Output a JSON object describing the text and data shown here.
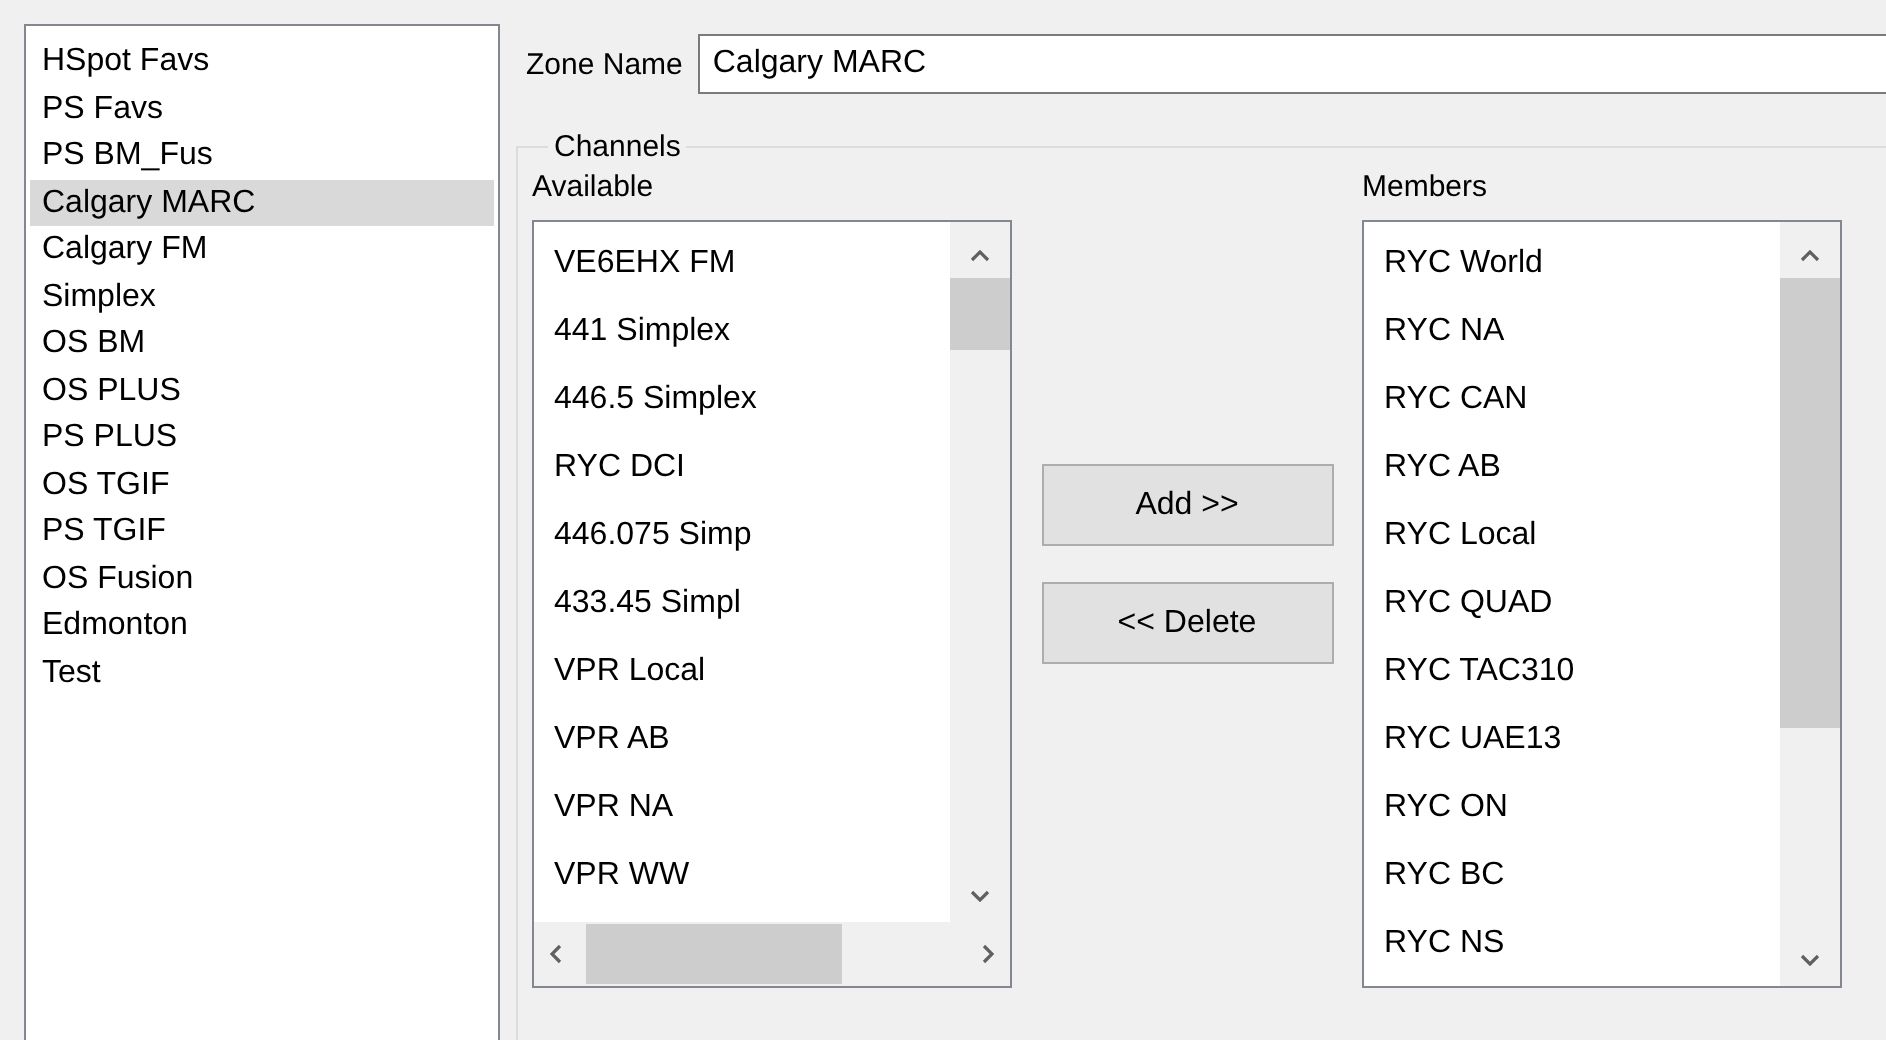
{
  "zones": [
    {
      "label": "HSpot Favs",
      "selected": false
    },
    {
      "label": "PS Favs",
      "selected": false
    },
    {
      "label": "PS BM_Fus",
      "selected": false
    },
    {
      "label": "Calgary MARC",
      "selected": true
    },
    {
      "label": "Calgary FM",
      "selected": false
    },
    {
      "label": "Simplex",
      "selected": false
    },
    {
      "label": "OS BM",
      "selected": false
    },
    {
      "label": "OS PLUS",
      "selected": false
    },
    {
      "label": "PS PLUS",
      "selected": false
    },
    {
      "label": "OS TGIF",
      "selected": false
    },
    {
      "label": "PS TGIF",
      "selected": false
    },
    {
      "label": "OS Fusion",
      "selected": false
    },
    {
      "label": "Edmonton",
      "selected": false
    },
    {
      "label": "Test",
      "selected": false
    }
  ],
  "zone_name": {
    "label": "Zone Name",
    "value": "Calgary MARC"
  },
  "channels": {
    "title": "Channels",
    "available": {
      "label": "Available",
      "items": [
        "VE6EHX FM",
        "441 Simplex",
        "446.5 Simplex",
        "RYC DCI",
        "446.075 Simp",
        "433.45 Simpl",
        "VPR Local",
        "VPR AB",
        "VPR NA",
        "VPR WW"
      ]
    },
    "buttons": [
      "Add >>",
      "<< Delete"
    ],
    "members": {
      "label": "Members",
      "items": [
        "RYC World",
        "RYC NA",
        "RYC CAN",
        "RYC AB",
        "RYC Local",
        "RYC QUAD",
        "RYC TAC310",
        "RYC UAE13",
        "RYC ON",
        "RYC BC",
        "RYC NS"
      ]
    }
  }
}
